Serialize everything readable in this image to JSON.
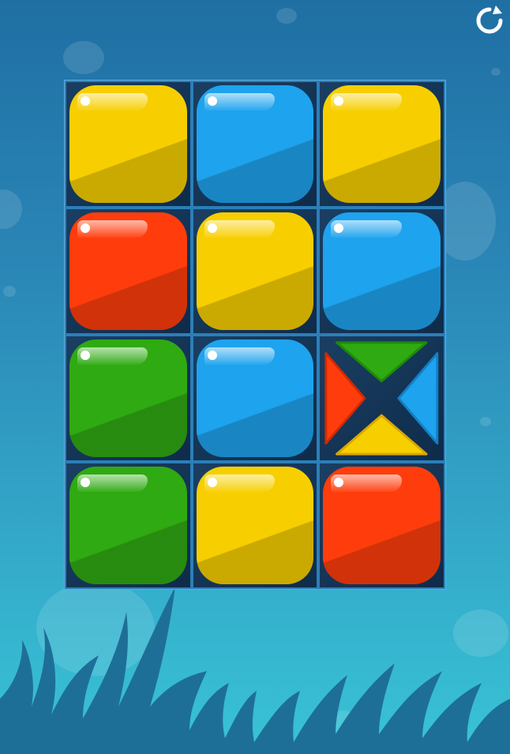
{
  "game": {
    "restart_icon": "restart-icon",
    "colors": {
      "yellow": "#f7cf00",
      "blue": "#1ea3ee",
      "red": "#ff3d0c",
      "green": "#2faa12"
    },
    "grid": [
      [
        "yellow",
        "blue",
        "yellow"
      ],
      [
        "red",
        "yellow",
        "blue"
      ],
      [
        "green",
        "blue",
        "split"
      ],
      [
        "green",
        "yellow",
        "red"
      ]
    ],
    "split_tile": {
      "top": "green",
      "right": "blue",
      "bottom": "yellow",
      "left": "red"
    }
  }
}
